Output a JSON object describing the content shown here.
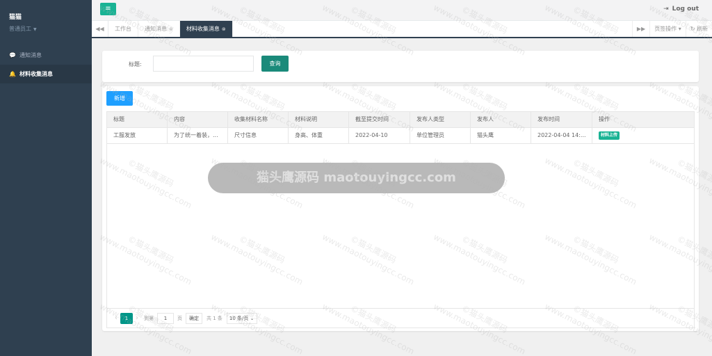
{
  "user": {
    "name": "猫猫",
    "role": "普通员工"
  },
  "sidebar": {
    "items": [
      {
        "label": "通知消息",
        "icon": "comment-icon",
        "active": false
      },
      {
        "label": "材料收集消息",
        "icon": "bell-icon",
        "active": true
      }
    ]
  },
  "header": {
    "logout_label": "Log out"
  },
  "tabs": {
    "items": [
      {
        "label": "工作台",
        "closable": false,
        "active": false
      },
      {
        "label": "通知消息",
        "closable": true,
        "active": false
      },
      {
        "label": "材料收集消息",
        "closable": true,
        "active": true
      }
    ],
    "page_ops_label": "页签操作",
    "refresh_label": "刷新"
  },
  "search": {
    "title_label": "标题:",
    "title_value": "",
    "query_button": "查询"
  },
  "table": {
    "add_button": "新增",
    "columns": [
      "标题",
      "内容",
      "收集材料名称",
      "材料说明",
      "截至提交时间",
      "发布人类型",
      "发布人",
      "发布时间",
      "操作"
    ],
    "rows": [
      {
        "title": "工服发放",
        "content": "为了统一着装，...",
        "material_name": "尺寸信息",
        "material_desc": "身高、体重",
        "deadline": "2022-04-10",
        "publisher_type": "单位管理员",
        "publisher": "猫头鹰",
        "publish_time": "2022-04-04 14:...",
        "action": "材料上传"
      }
    ]
  },
  "pager": {
    "current_page": "1",
    "goto_label": "到第",
    "goto_value": "1",
    "page_unit": "页",
    "confirm": "确定",
    "total": "共 1 条",
    "page_size": "10 条/页"
  },
  "watermark": {
    "banner": "猫头鹰源码 maotouyingcc.com",
    "tile_line1": "©猫头鹰源码",
    "tile_line2": "www.maotouyingcc.com"
  },
  "colors": {
    "sidebar": "#2f4050",
    "accent": "#1ab394",
    "primary_blue": "#1e9fff",
    "query_button": "#1a8a7a"
  }
}
